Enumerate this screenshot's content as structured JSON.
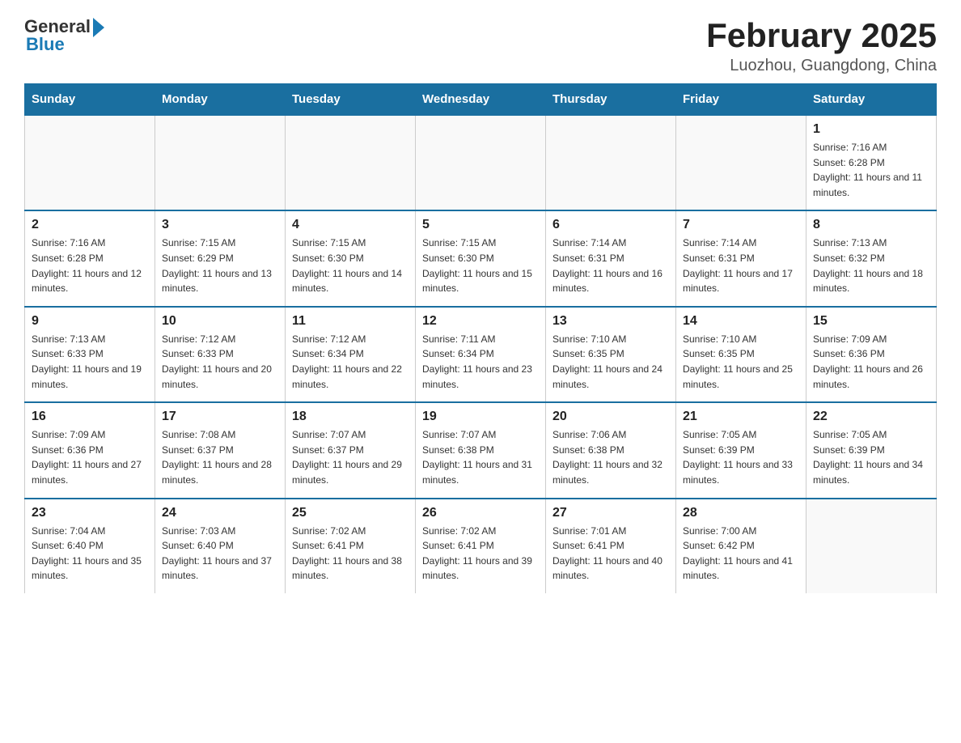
{
  "header": {
    "logo_general": "General",
    "logo_blue": "Blue",
    "month_title": "February 2025",
    "location": "Luozhou, Guangdong, China"
  },
  "weekdays": [
    "Sunday",
    "Monday",
    "Tuesday",
    "Wednesday",
    "Thursday",
    "Friday",
    "Saturday"
  ],
  "weeks": [
    [
      {
        "day": "",
        "info": ""
      },
      {
        "day": "",
        "info": ""
      },
      {
        "day": "",
        "info": ""
      },
      {
        "day": "",
        "info": ""
      },
      {
        "day": "",
        "info": ""
      },
      {
        "day": "",
        "info": ""
      },
      {
        "day": "1",
        "info": "Sunrise: 7:16 AM\nSunset: 6:28 PM\nDaylight: 11 hours and 11 minutes."
      }
    ],
    [
      {
        "day": "2",
        "info": "Sunrise: 7:16 AM\nSunset: 6:28 PM\nDaylight: 11 hours and 12 minutes."
      },
      {
        "day": "3",
        "info": "Sunrise: 7:15 AM\nSunset: 6:29 PM\nDaylight: 11 hours and 13 minutes."
      },
      {
        "day": "4",
        "info": "Sunrise: 7:15 AM\nSunset: 6:30 PM\nDaylight: 11 hours and 14 minutes."
      },
      {
        "day": "5",
        "info": "Sunrise: 7:15 AM\nSunset: 6:30 PM\nDaylight: 11 hours and 15 minutes."
      },
      {
        "day": "6",
        "info": "Sunrise: 7:14 AM\nSunset: 6:31 PM\nDaylight: 11 hours and 16 minutes."
      },
      {
        "day": "7",
        "info": "Sunrise: 7:14 AM\nSunset: 6:31 PM\nDaylight: 11 hours and 17 minutes."
      },
      {
        "day": "8",
        "info": "Sunrise: 7:13 AM\nSunset: 6:32 PM\nDaylight: 11 hours and 18 minutes."
      }
    ],
    [
      {
        "day": "9",
        "info": "Sunrise: 7:13 AM\nSunset: 6:33 PM\nDaylight: 11 hours and 19 minutes."
      },
      {
        "day": "10",
        "info": "Sunrise: 7:12 AM\nSunset: 6:33 PM\nDaylight: 11 hours and 20 minutes."
      },
      {
        "day": "11",
        "info": "Sunrise: 7:12 AM\nSunset: 6:34 PM\nDaylight: 11 hours and 22 minutes."
      },
      {
        "day": "12",
        "info": "Sunrise: 7:11 AM\nSunset: 6:34 PM\nDaylight: 11 hours and 23 minutes."
      },
      {
        "day": "13",
        "info": "Sunrise: 7:10 AM\nSunset: 6:35 PM\nDaylight: 11 hours and 24 minutes."
      },
      {
        "day": "14",
        "info": "Sunrise: 7:10 AM\nSunset: 6:35 PM\nDaylight: 11 hours and 25 minutes."
      },
      {
        "day": "15",
        "info": "Sunrise: 7:09 AM\nSunset: 6:36 PM\nDaylight: 11 hours and 26 minutes."
      }
    ],
    [
      {
        "day": "16",
        "info": "Sunrise: 7:09 AM\nSunset: 6:36 PM\nDaylight: 11 hours and 27 minutes."
      },
      {
        "day": "17",
        "info": "Sunrise: 7:08 AM\nSunset: 6:37 PM\nDaylight: 11 hours and 28 minutes."
      },
      {
        "day": "18",
        "info": "Sunrise: 7:07 AM\nSunset: 6:37 PM\nDaylight: 11 hours and 29 minutes."
      },
      {
        "day": "19",
        "info": "Sunrise: 7:07 AM\nSunset: 6:38 PM\nDaylight: 11 hours and 31 minutes."
      },
      {
        "day": "20",
        "info": "Sunrise: 7:06 AM\nSunset: 6:38 PM\nDaylight: 11 hours and 32 minutes."
      },
      {
        "day": "21",
        "info": "Sunrise: 7:05 AM\nSunset: 6:39 PM\nDaylight: 11 hours and 33 minutes."
      },
      {
        "day": "22",
        "info": "Sunrise: 7:05 AM\nSunset: 6:39 PM\nDaylight: 11 hours and 34 minutes."
      }
    ],
    [
      {
        "day": "23",
        "info": "Sunrise: 7:04 AM\nSunset: 6:40 PM\nDaylight: 11 hours and 35 minutes."
      },
      {
        "day": "24",
        "info": "Sunrise: 7:03 AM\nSunset: 6:40 PM\nDaylight: 11 hours and 37 minutes."
      },
      {
        "day": "25",
        "info": "Sunrise: 7:02 AM\nSunset: 6:41 PM\nDaylight: 11 hours and 38 minutes."
      },
      {
        "day": "26",
        "info": "Sunrise: 7:02 AM\nSunset: 6:41 PM\nDaylight: 11 hours and 39 minutes."
      },
      {
        "day": "27",
        "info": "Sunrise: 7:01 AM\nSunset: 6:41 PM\nDaylight: 11 hours and 40 minutes."
      },
      {
        "day": "28",
        "info": "Sunrise: 7:00 AM\nSunset: 6:42 PM\nDaylight: 11 hours and 41 minutes."
      },
      {
        "day": "",
        "info": ""
      }
    ]
  ]
}
